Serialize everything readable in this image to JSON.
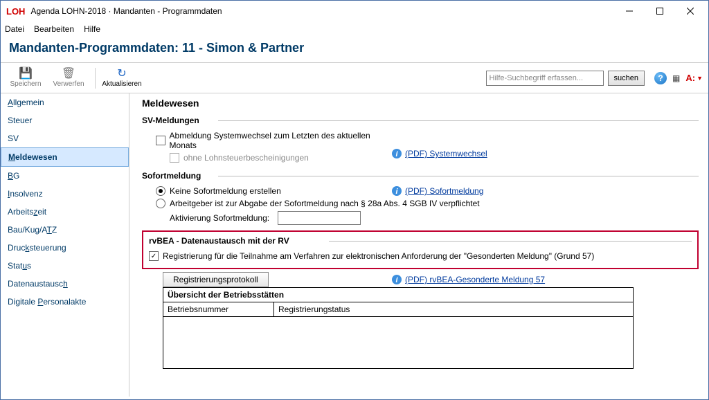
{
  "titlebar": {
    "brand": "LOH",
    "text": "Agenda LOHN-2018 · Mandanten - Programmdaten"
  },
  "menu": {
    "file": "Datei",
    "edit": "Bearbeiten",
    "help": "Hilfe"
  },
  "page_header": "Mandanten-Programmdaten: 11 - Simon & Partner",
  "toolbar": {
    "save": "Speichern",
    "discard": "Verwerfen",
    "refresh": "Aktualisieren",
    "search_placeholder": "Hilfe-Suchbegriff erfassen...",
    "search_btn": "suchen"
  },
  "sidebar": {
    "items": [
      {
        "label": "Allgemein",
        "ul": "A"
      },
      {
        "label": "Steuer",
        "ul": ""
      },
      {
        "label": "SV",
        "ul": ""
      },
      {
        "label": "Meldewesen",
        "ul": "M",
        "active": true
      },
      {
        "label": "BG",
        "ul": "B"
      },
      {
        "label": "Insolvenz",
        "ul": "I"
      },
      {
        "label": "Arbeitszeit",
        "ul": ""
      },
      {
        "label": "Bau/Kug/ATZ",
        "ul": ""
      },
      {
        "label": "Drucksteuerung",
        "ul": ""
      },
      {
        "label": "Status",
        "ul": ""
      },
      {
        "label": "Datenaustausch",
        "ul": ""
      },
      {
        "label": "Digitale Personalakte",
        "ul": "P"
      }
    ]
  },
  "content": {
    "heading": "Meldewesen",
    "sv": {
      "title": "SV-Meldungen",
      "chk_abmeldung": "Abmeldung Systemwechsel zum Letzten des aktuellen Monats",
      "chk_ohne": "ohne Lohnsteuerbescheinigungen",
      "link_pdf": "(PDF) Systemwechsel"
    },
    "sofort": {
      "title": "Sofortmeldung",
      "radio_none": "Keine Sofortmeldung erstellen",
      "radio_employer": "Arbeitgeber ist zur Abgabe der Sofortmeldung nach § 28a Abs. 4 SGB IV verpflichtet",
      "activation_label": "Aktivierung Sofortmeldung:",
      "link_pdf": "(PDF) Sofortmeldung"
    },
    "rvbea": {
      "title": "rvBEA - Datenaustausch mit der RV",
      "chk_reg": "Registrierung für die Teilnahme am Verfahren zur elektronischen Anforderung der \"Gesonderten Meldung\" (Grund 57)",
      "btn_protocol": "Registrierungsprotokoll",
      "link_pdf": "(PDF) rvBEA-Gesonderte Meldung 57"
    },
    "overview": {
      "title": "Übersicht der Betriebsstätten",
      "col1": "Betriebsnummer",
      "col2": "Registrierungstatus"
    }
  }
}
